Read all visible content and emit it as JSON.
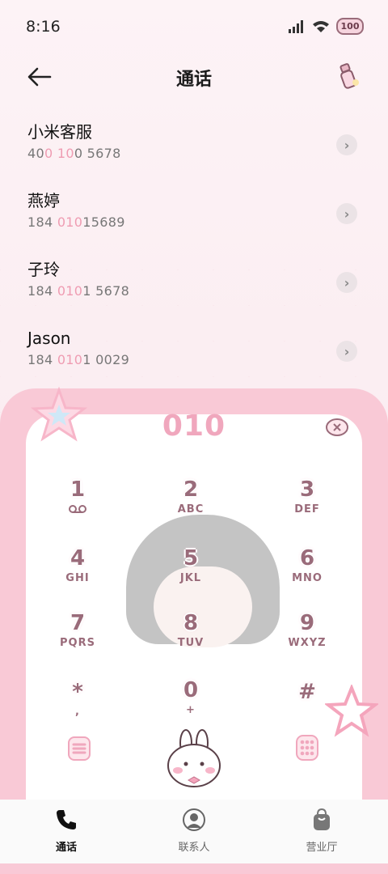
{
  "status": {
    "time": "8:16",
    "battery": "100"
  },
  "header": {
    "title": "通话"
  },
  "contacts": [
    {
      "name": "小米客服",
      "num_pre": "40",
      "num_hl1": "0 ",
      "num_mid": "10",
      "num_hl2": "",
      "num_post": "0 5678"
    },
    {
      "name": "燕婷",
      "num_pre": "184 ",
      "num_hl1": "010",
      "num_mid": "15689",
      "num_hl2": "",
      "num_post": ""
    },
    {
      "name": "子玲",
      "num_pre": "184 ",
      "num_hl1": "010",
      "num_mid": "1 5678",
      "num_hl2": "",
      "num_post": ""
    },
    {
      "name": "Jason",
      "num_pre": "184 ",
      "num_hl1": "010",
      "num_mid": "1 0029",
      "num_hl2": "",
      "num_post": ""
    }
  ],
  "dialer": {
    "digits": "010",
    "keys": [
      {
        "d": "1",
        "l": ""
      },
      {
        "d": "2",
        "l": "ABC"
      },
      {
        "d": "3",
        "l": "DEF"
      },
      {
        "d": "4",
        "l": "GHI"
      },
      {
        "d": "5",
        "l": "JKL"
      },
      {
        "d": "6",
        "l": "MNO"
      },
      {
        "d": "7",
        "l": "PQRS"
      },
      {
        "d": "8",
        "l": "TUV"
      },
      {
        "d": "9",
        "l": "WXYZ"
      },
      {
        "d": "*",
        "l": ","
      },
      {
        "d": "0",
        "l": "+"
      },
      {
        "d": "#",
        "l": ""
      }
    ]
  },
  "tabs": [
    {
      "label": "通话",
      "icon": "phone-icon"
    },
    {
      "label": "联系人",
      "icon": "person-icon"
    },
    {
      "label": "营业厅",
      "icon": "bag-icon"
    }
  ],
  "colors": {
    "accent": "#f0a7bd",
    "key": "#9a6b7a",
    "panel": "#f9c9d6"
  }
}
